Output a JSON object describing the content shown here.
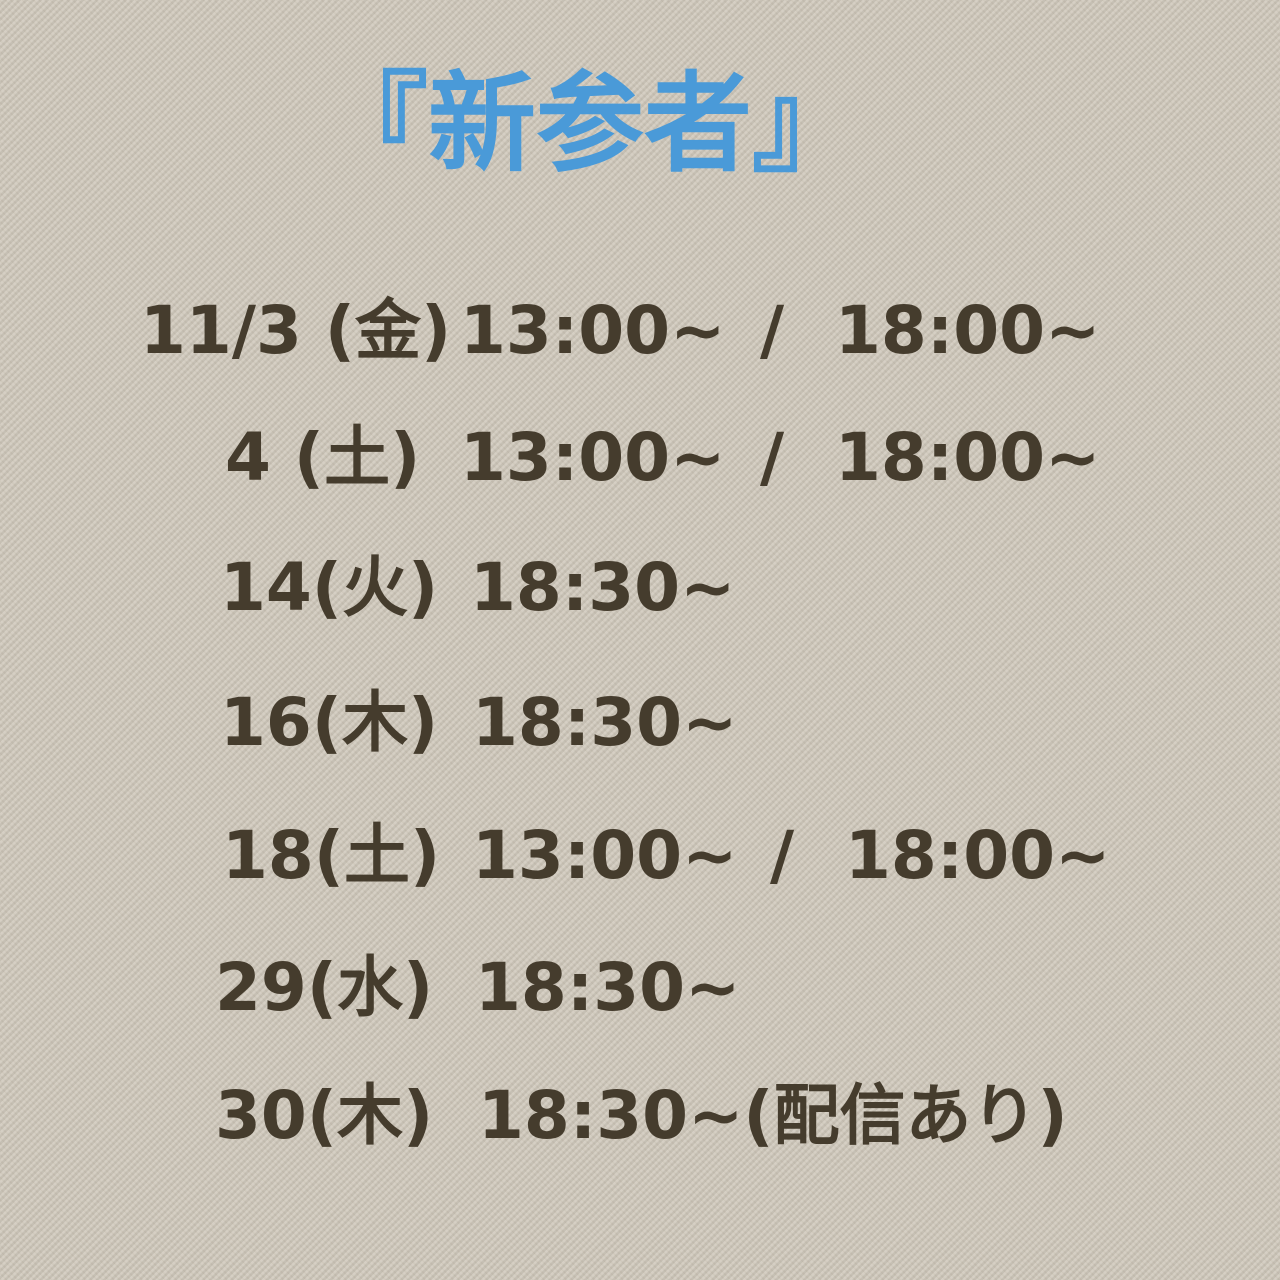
{
  "title": "『新参者』",
  "schedule": [
    {
      "date": "11/3 (金)",
      "times": [
        "13:00~",
        "18:00~"
      ]
    },
    {
      "date": "4 (土)",
      "times": [
        "13:00~",
        "18:00~"
      ]
    },
    {
      "date": "14(火)",
      "times": [
        "18:30~"
      ]
    },
    {
      "date": "16(木)",
      "times": [
        "18:30~"
      ]
    },
    {
      "date": "18(土)",
      "times": [
        "13:00~",
        "18:00~"
      ]
    },
    {
      "date": "29(水)",
      "times": [
        "18:30~"
      ]
    },
    {
      "date": "30(木)",
      "times": [
        "18:30~(配信あり)"
      ]
    }
  ],
  "separator": "/",
  "colors": {
    "title": "#4a9ad8",
    "text": "#453c2d",
    "background": "#cfc8bb"
  }
}
